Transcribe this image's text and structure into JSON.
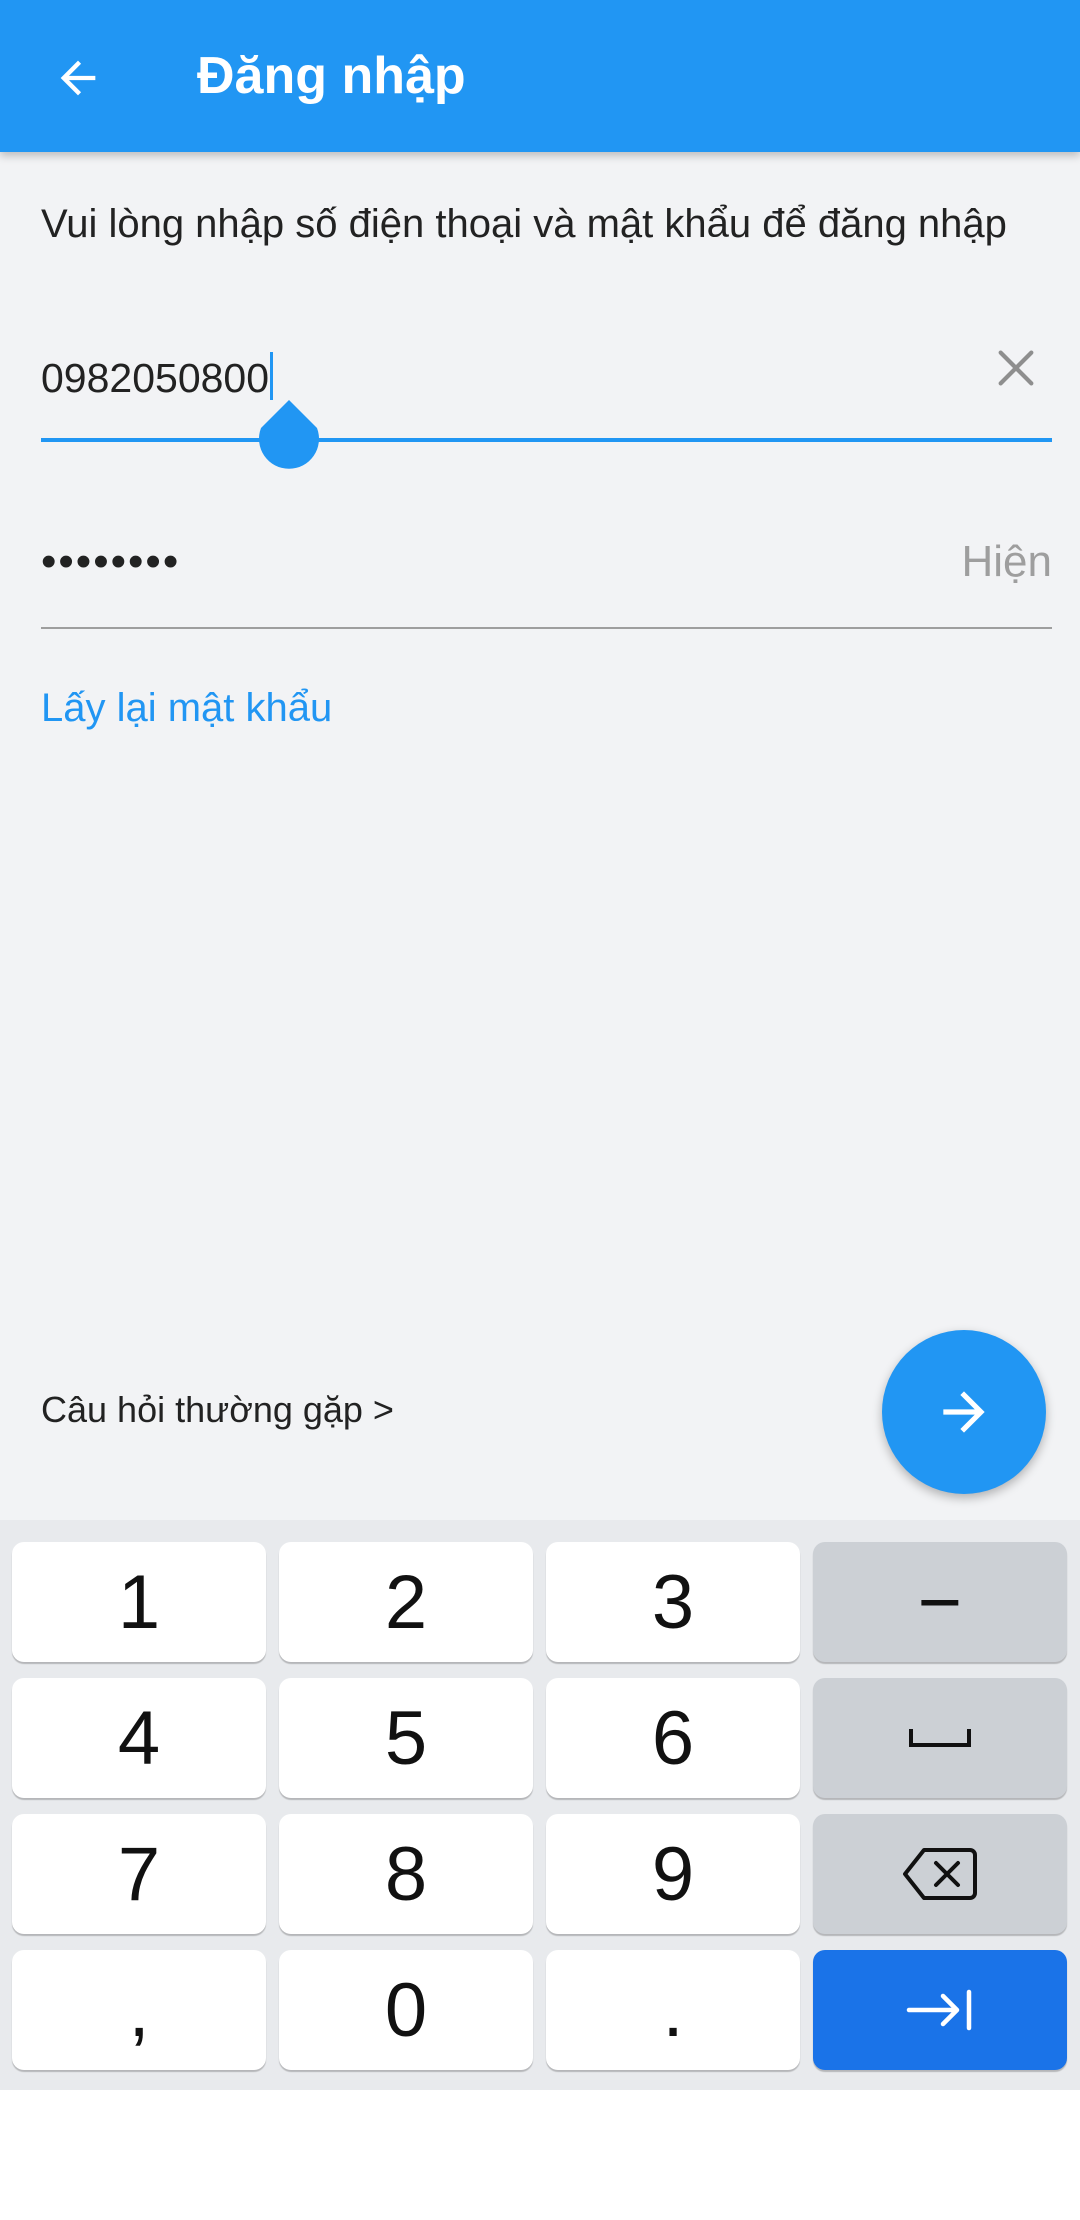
{
  "app_bar": {
    "title": "Đăng nhập",
    "back_icon": "arrow-left-icon",
    "background": "#2196f3"
  },
  "login": {
    "instruction": "Vui lòng nhập số điện thoại và mật khẩu để đăng nhập",
    "phone_value": "0982050800",
    "clear_icon": "close-icon",
    "password_mask": "••••••••",
    "show_password_label": "Hiện",
    "forgot_password_label": "Lấy lại mật khẩu",
    "faq_label": "Câu hỏi thường gặp >",
    "submit_icon": "arrow-right-icon"
  },
  "keyboard": {
    "rows": [
      [
        "1",
        "2",
        "3",
        "−"
      ],
      [
        "4",
        "5",
        "6",
        "space-icon"
      ],
      [
        "7",
        "8",
        "9",
        "backspace-icon"
      ],
      [
        ",",
        "0",
        ".",
        "next-tab-icon"
      ]
    ],
    "key_1": "1",
    "key_2": "2",
    "key_3": "3",
    "key_minus": "−",
    "key_4": "4",
    "key_5": "5",
    "key_6": "6",
    "key_7": "7",
    "key_8": "8",
    "key_9": "9",
    "key_comma": ",",
    "key_0": "0",
    "key_period": ".",
    "colors": {
      "key": "#ffffff",
      "function_key": "#ccd0d5",
      "action_key": "#1a73e8"
    }
  }
}
